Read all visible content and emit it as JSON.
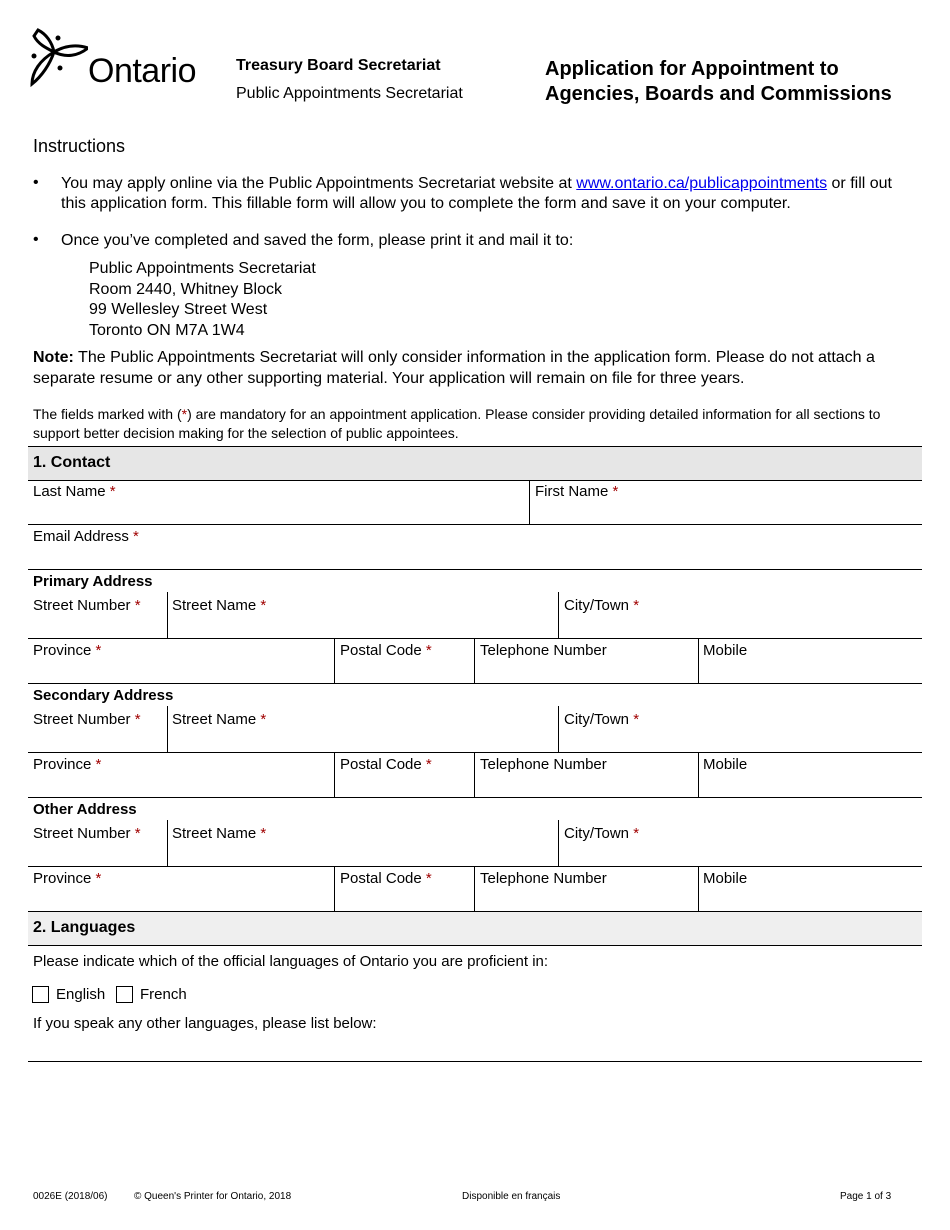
{
  "header": {
    "logo_text": "Ontario",
    "department": "Treasury Board Secretariat",
    "sub_department": "Public Appointments Secretariat",
    "title_line1": "Application for Appointment to",
    "title_line2": "Agencies, Boards and Commissions"
  },
  "instructions": {
    "heading": "Instructions",
    "bullet1_pre": "You may apply online via the Public Appointments Secretariat website at ",
    "bullet1_link": "www.ontario.ca/publicappointments",
    "bullet1_post": " or fill out this application form. This fillable form will allow you to complete the form and save it on your computer.",
    "bullet2": "Once you’ve completed and saved the form, please print it and mail it to:",
    "address": [
      "Public Appointments Secretariat",
      "Room 2440, Whitney Block",
      "99 Wellesley Street West",
      "Toronto ON  M7A 1W4"
    ],
    "note_label": "Note:",
    "note_text": " The Public Appointments Secretariat will only consider information in the application form. Please do not attach a separate resume or any other supporting material. Your application will remain on file for three years.",
    "mandatory_pre": "The fields marked with (",
    "mandatory_star": "*",
    "mandatory_post": ")  are mandatory for an appointment application. Please consider providing detailed information for all sections to support better decision making for the selection of public appointees.",
    "bullet_char": "•"
  },
  "contact": {
    "heading": "1. Contact",
    "last_name": "Last Name",
    "first_name": "First Name",
    "email": "Email Address",
    "star": "*",
    "addresses": [
      {
        "title": "Primary Address"
      },
      {
        "title": "Secondary Address"
      },
      {
        "title": "Other Address"
      }
    ],
    "street_number": "Street Number",
    "street_name": "Street Name",
    "city": "City/Town",
    "province": "Province",
    "postal_code": "Postal Code",
    "telephone": "Telephone Number",
    "mobile": "Mobile"
  },
  "languages": {
    "heading": "2. Languages",
    "prompt": "Please indicate which of the official languages of Ontario you are proficient in:",
    "options": [
      {
        "label": "English",
        "checked": false
      },
      {
        "label": "French",
        "checked": false
      }
    ],
    "other_prompt": "If you speak any other languages, please list below:"
  },
  "footer": {
    "form_number": "0026E (2018/06)",
    "copyright": "© Queen's Printer for Ontario, 2018",
    "french": "Disponible en français",
    "page": "Page 1 of 3"
  }
}
